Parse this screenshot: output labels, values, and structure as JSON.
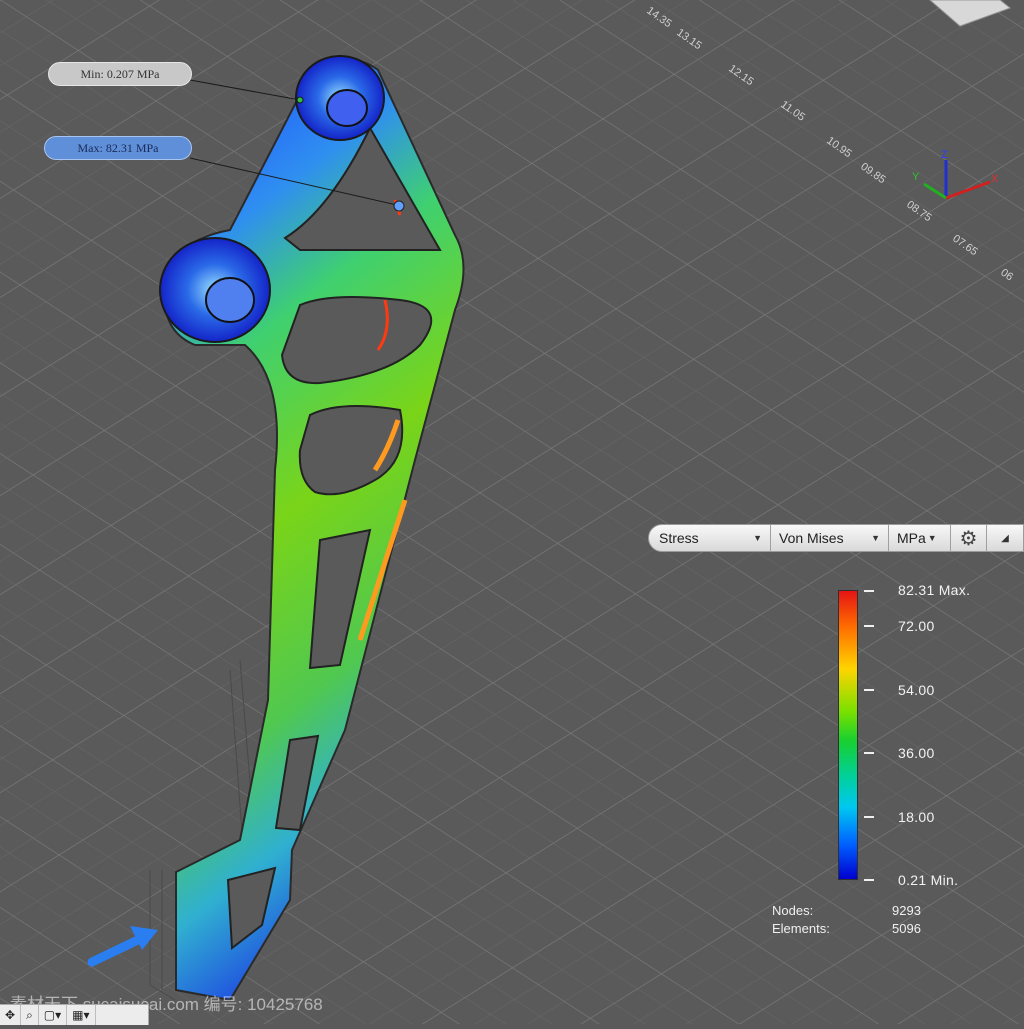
{
  "callouts": {
    "min_text": "Min: 0.207 MPa",
    "max_text": "Max: 82.31 MPa"
  },
  "toolbar": {
    "result_type": "Stress",
    "stress_type": "Von Mises",
    "unit": "MPa",
    "settings_icon": "gear-icon",
    "collapse_icon": "collapse-triangle-icon"
  },
  "legend": {
    "max_label": "82.31 Max.",
    "t72": "72.00",
    "t54": "54.00",
    "t36": "36.00",
    "t18": "18.00",
    "min_label": "0.21 Min."
  },
  "mesh_info": {
    "nodes_label": "Nodes:",
    "nodes_value": "9293",
    "elements_label": "Elements:",
    "elements_value": "5096"
  },
  "grid_labels": [
    "14.35",
    "13.15",
    "12.15",
    "11.05",
    "10.95",
    "09.85",
    "08.75",
    "07.65",
    "06"
  ],
  "axis_triad": {
    "x": "X",
    "y": "Y",
    "z": "Z"
  },
  "bottom_bar": {
    "pan_icon": "pan-icon",
    "zoom_icon": "zoom-icon",
    "display_icon": "display-mode-icon",
    "grid_icon": "grid-icon"
  },
  "watermark": "素材天下 sucaisucai.com  编号: 10425768",
  "colors": {
    "background": "#5a5a5a",
    "max_stress": "#e41414",
    "min_stress": "#0000d0",
    "max_callout": "#5f8fd9",
    "min_callout": "#c8c8c8"
  }
}
